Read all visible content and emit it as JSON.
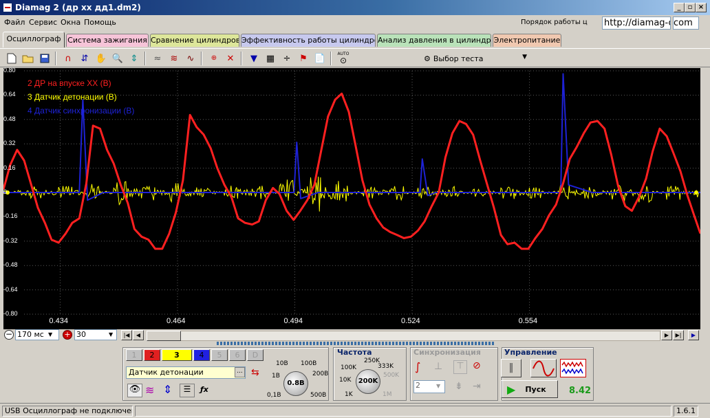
{
  "window": {
    "title": "Diamag 2 (др хх дд1.dm2)",
    "buttons": [
      "_",
      "▫",
      "×"
    ]
  },
  "menu": {
    "items": [
      "Файл",
      "Сервис",
      "Окна",
      "Помощь"
    ],
    "help_link": "Порядок работы ц",
    "url_box": "http://diamag-osc.com",
    "url_box2": "com"
  },
  "tabs": [
    {
      "label": "Осциллограф",
      "color": "#d4d0c8",
      "active": true
    },
    {
      "label": "Система зажигания",
      "color": "#f6c4d8",
      "active": false
    },
    {
      "label": "Сравнение цилиндров",
      "color": "#dde69a",
      "active": false
    },
    {
      "label": "Эффективность работы цилиндров",
      "color": "#c7c9ee",
      "active": false
    },
    {
      "label": "Анализ давления в цилиндре",
      "color": "#b9e2b9",
      "active": false
    },
    {
      "label": "Электропитание",
      "color": "#f0c8b0",
      "active": false
    }
  ],
  "toolbar": {
    "test_select": "Выбор теста",
    "auto_label": "AUTO"
  },
  "scope": {
    "legend": [
      {
        "text": "2 ДР на впуске ХХ (В)",
        "color": "#ff2020"
      },
      {
        "text": "3 Датчик детонации (В)",
        "color": "#ffff00"
      },
      {
        "text": "4 Датчик синхронизации (В)",
        "color": "#1e22d6"
      }
    ],
    "y_ticks": [
      "0.80",
      "0.64",
      "0.48",
      "0.32",
      "0.16",
      "0",
      "-0.16",
      "-0.32",
      "-0.48",
      "-0.64",
      "-0.80"
    ],
    "x_ticks": [
      "0.434",
      "0.464",
      "0.494",
      "0.524",
      "0.554"
    ]
  },
  "chart_data": {
    "type": "line",
    "ylim": [
      -0.8,
      0.8
    ],
    "xlim": [
      0.4195,
      0.5977
    ],
    "series": [
      {
        "name": "2 ДР на впуске ХХ (В)",
        "color": "#ff2020",
        "x": [
          0.4195,
          0.4212,
          0.423,
          0.4248,
          0.4265,
          0.4283,
          0.4301,
          0.4318,
          0.4336,
          0.4354,
          0.4371,
          0.4389,
          0.4407,
          0.4424,
          0.4442,
          0.446,
          0.4477,
          0.4495,
          0.4513,
          0.453,
          0.4548,
          0.4566,
          0.4583,
          0.4601,
          0.4619,
          0.4636,
          0.4654,
          0.4672,
          0.4689,
          0.4707,
          0.4725,
          0.4742,
          0.476,
          0.4778,
          0.4795,
          0.4813,
          0.4831,
          0.4848,
          0.4866,
          0.4884,
          0.4901,
          0.4919,
          0.4937,
          0.4954,
          0.4972,
          0.499,
          0.5007,
          0.5025,
          0.5043,
          0.506,
          0.5078,
          0.5096,
          0.5113,
          0.5131,
          0.5149,
          0.5166,
          0.5184,
          0.5202,
          0.5219,
          0.5237,
          0.5255,
          0.5272,
          0.529,
          0.5308,
          0.5325,
          0.5343,
          0.5361,
          0.5378,
          0.5396,
          0.5414,
          0.5431,
          0.5449,
          0.5467,
          0.5484,
          0.5502,
          0.552,
          0.5537,
          0.5555,
          0.5573,
          0.559,
          0.5608,
          0.5626,
          0.5643,
          0.5661,
          0.5679,
          0.5696,
          0.5714,
          0.5732,
          0.5749,
          0.5767,
          0.5785,
          0.5802,
          0.582,
          0.5838,
          0.5855,
          0.5873,
          0.5891,
          0.5908,
          0.5926,
          0.5944,
          0.5961,
          0.5977
        ],
        "y": [
          0.02,
          0.18,
          0.28,
          0.21,
          0.06,
          -0.1,
          -0.2,
          -0.31,
          -0.33,
          -0.27,
          -0.2,
          -0.17,
          0.06,
          0.44,
          0.42,
          0.28,
          0.19,
          0.05,
          -0.07,
          -0.24,
          -0.29,
          -0.31,
          -0.37,
          -0.37,
          -0.27,
          -0.13,
          0.08,
          0.51,
          0.43,
          0.38,
          0.29,
          0.16,
          0.05,
          -0.03,
          -0.17,
          -0.2,
          -0.21,
          -0.19,
          -0.05,
          0.03,
          -0.01,
          -0.12,
          -0.18,
          -0.12,
          -0.05,
          0.05,
          0.27,
          0.5,
          0.61,
          0.65,
          0.53,
          0.3,
          0.08,
          -0.08,
          -0.17,
          -0.23,
          -0.26,
          -0.28,
          -0.3,
          -0.29,
          -0.25,
          -0.19,
          -0.09,
          0.0,
          0.23,
          0.39,
          0.47,
          0.45,
          0.38,
          0.21,
          0.06,
          -0.1,
          -0.28,
          -0.34,
          -0.33,
          -0.37,
          -0.37,
          -0.3,
          -0.24,
          -0.15,
          -0.08,
          0.06,
          0.22,
          0.3,
          0.39,
          0.46,
          0.47,
          0.42,
          0.25,
          0.04,
          -0.09,
          -0.12,
          -0.03,
          0.09,
          0.27,
          0.42,
          0.37,
          0.26,
          0.14,
          -0.02,
          -0.15,
          -0.27
        ]
      },
      {
        "name": "3 Датчик детонации (В)",
        "color": "#ffff00",
        "x": [
          0.4195,
          0.423,
          0.4265,
          0.4301,
          0.4336,
          0.4371,
          0.4407,
          0.4442,
          0.4477,
          0.4513,
          0.4548,
          0.4583,
          0.4619,
          0.4654,
          0.4689,
          0.4725,
          0.476,
          0.4795,
          0.4831,
          0.4866,
          0.4901,
          0.4937,
          0.4972,
          0.5007,
          0.5043,
          0.5078,
          0.5113,
          0.5149,
          0.5184,
          0.5219,
          0.5255,
          0.529,
          0.5325,
          0.5361,
          0.5396,
          0.5431,
          0.5467,
          0.5502,
          0.5537,
          0.5573,
          0.5608,
          0.5643,
          0.5679,
          0.5714,
          0.5749,
          0.5785,
          0.582,
          0.5855,
          0.5891,
          0.5926,
          0.5961,
          0.5977
        ],
        "y": [
          0.0,
          0.02,
          0.05,
          0.01,
          0.06,
          -0.01,
          0.08,
          0.0,
          0.12,
          0.03,
          0.07,
          0.01,
          0.1,
          0.02,
          0.04,
          0.0,
          0.08,
          0.02,
          0.06,
          0.0,
          0.13,
          0.02,
          0.2,
          -0.06,
          0.12,
          0.0,
          0.05,
          0.02,
          0.07,
          0.0,
          0.06,
          0.01,
          0.05,
          0.0,
          0.04,
          0.0,
          0.06,
          0.02,
          0.05,
          0.0,
          0.07,
          0.02,
          0.06,
          0.01,
          0.12,
          0.02,
          0.1,
          0.0,
          0.07,
          0.0,
          0.05,
          0.0
        ]
      },
      {
        "name": "4 Датчик синхронизации (В)",
        "color": "#1e22d6",
        "x": [
          0.4195,
          0.4301,
          0.4389,
          0.4398,
          0.441,
          0.445,
          0.48,
          0.4938,
          0.4945,
          0.4955,
          0.5,
          0.526,
          0.5266,
          0.528,
          0.53,
          0.562,
          0.5626,
          0.564,
          0.57,
          0.5977
        ],
        "y": [
          0.0,
          0.0,
          0.0,
          0.61,
          -0.05,
          0.0,
          0.0,
          0.0,
          0.33,
          -0.04,
          0.0,
          0.0,
          0.22,
          -0.02,
          0.0,
          0.0,
          0.78,
          0.05,
          0.0,
          0.0
        ]
      }
    ]
  },
  "scroll_row": {
    "time_value": "170 мс",
    "zoom_value": "30"
  },
  "channels": {
    "buttons": [
      "1",
      "2",
      "3",
      "4",
      "5",
      "6",
      "D"
    ],
    "selected_name": "Датчик детонации",
    "scale": "0.8В",
    "scale_labels": [
      "10В",
      "100В",
      "1В",
      "200В",
      "0,1В",
      "500В"
    ]
  },
  "frequency": {
    "label": "Частота",
    "value": "200K",
    "labels": [
      "250K",
      "100K",
      "333K",
      "500K",
      "10K",
      "1K",
      "1M"
    ]
  },
  "sync": {
    "label": "Синхронизация",
    "channel": "2"
  },
  "control": {
    "label": "Управление",
    "start_label": "Пуск",
    "value": "8.42"
  },
  "status": {
    "text": "USB Осциллограф не подключен",
    "version": "1.6.1"
  }
}
